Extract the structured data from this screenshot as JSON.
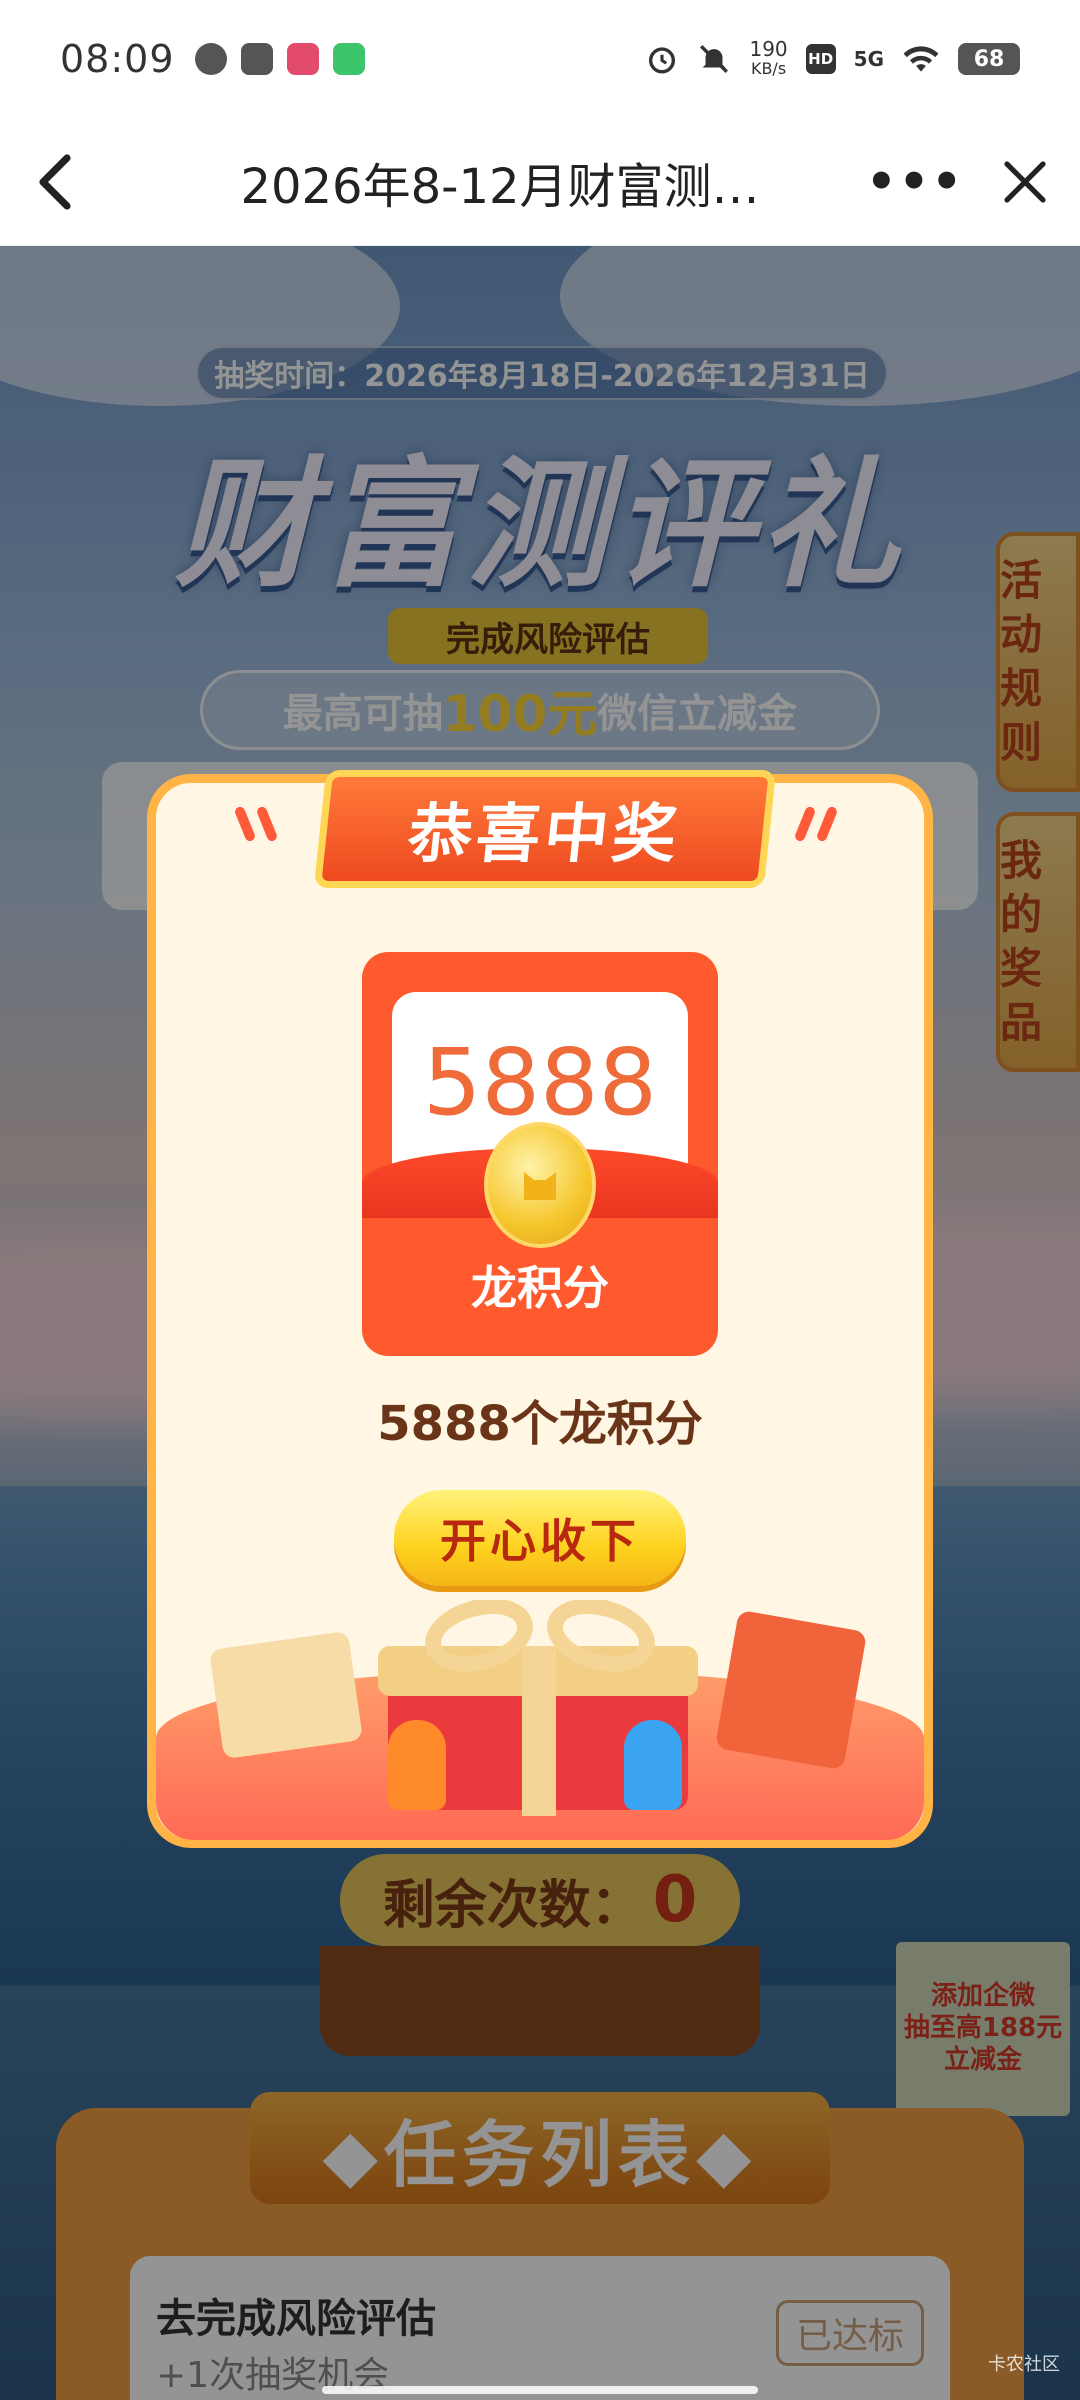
{
  "status_bar": {
    "time": "08:09",
    "net_speed_value": "190",
    "net_speed_unit": "KB/s",
    "hd": "HD",
    "signal": "5G",
    "battery": "68"
  },
  "nav": {
    "title": "2026年8-12月财富测…",
    "more": "•••"
  },
  "page": {
    "lottery_time": "抽奖时间：2026年8月18日-2026年12月31日",
    "big_title": "财富测评礼",
    "ribbon": "完成风险评估",
    "subtitle_prefix": "最高可抽",
    "subtitle_amount": "100元",
    "subtitle_suffix": "微信立减金",
    "side_tab_rules": "活动规则",
    "side_tab_prizes": "我的奖品",
    "remaining_label": "剩余次数：",
    "remaining_count": "0",
    "promo_line1": "添加企微",
    "promo_line2": "抽至高188元",
    "promo_line3": "立减金",
    "task_header": "◆任务列表◆",
    "task_title": "去完成风险评估",
    "task_sub": "+1次抽奖机会",
    "task_button": "已达标",
    "watermark": "卡农社区"
  },
  "modal": {
    "header": "恭喜中奖",
    "envelope_amount": "5888",
    "envelope_label": "龙积分",
    "prize_text": "5888个龙积分",
    "accept_button": "开心收下"
  },
  "colors": {
    "accent_orange": "#ff5a2e",
    "modal_border": "#ffb445",
    "button_yellow": "#ffd21f"
  }
}
